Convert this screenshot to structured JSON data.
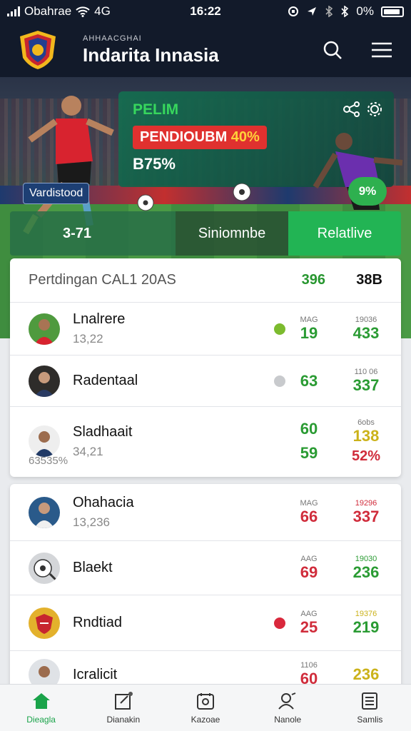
{
  "status_bar": {
    "carrier": "Obahrae",
    "network": "4G",
    "time": "16:22",
    "battery": "0%"
  },
  "header": {
    "subtitle": "AHHAACGHAI",
    "title": "Indarita Innasia"
  },
  "hero": {
    "player_badge": "Vardistood",
    "card_label": "PELIM",
    "pill_text": "PENDIOUBM",
    "pill_highlight": "40%",
    "card_value": "B75%",
    "pct_badge": "9%"
  },
  "segments": [
    "3-71",
    "Siniomnbe",
    "Relatlive"
  ],
  "card1": {
    "header": {
      "title": "Pertdingan CAL1 20AS",
      "col1": "396",
      "col2": "38B"
    },
    "rows": [
      {
        "name": "Lnalrere",
        "meta": "13,22",
        "dot_color": "#7cbb2e",
        "a_small": "MAG",
        "a_big": "19",
        "a_color": "green",
        "b_small": "19036",
        "b_big": "433",
        "b_color": "green"
      },
      {
        "name": "Radentaal",
        "meta": "",
        "dot_color": "#c8cacd",
        "a_small": "",
        "a_big": "63",
        "a_color": "green",
        "b_small": "110 06",
        "b_big": "337",
        "b_color": "green"
      },
      {
        "name": "Sladhaait",
        "meta": "34,21",
        "extra": "63535%",
        "dot_color": "",
        "a_small": "",
        "a_big": "60",
        "a_big2": "59",
        "a_color": "green",
        "b_small": "6obs",
        "b_big": "138",
        "b_big2": "52%",
        "b_color": "yellow"
      }
    ]
  },
  "card2": {
    "rows": [
      {
        "name": "Ohahacia",
        "meta": "13,236",
        "dot_color": "",
        "a_small": "MAG",
        "a_big": "66",
        "a_color": "red",
        "b_small": "19296",
        "b_big": "337",
        "b_color": "red"
      },
      {
        "name": "Blaekt",
        "meta": "",
        "dot_color": "",
        "a_small": "AAG",
        "a_big": "69",
        "a_color": "red",
        "b_small": "19030",
        "b_big": "236",
        "b_color": "green"
      },
      {
        "name": "Rndtiad",
        "meta": "",
        "dot_color": "#d9283c",
        "a_small": "AAG",
        "a_big": "25",
        "a_color": "red",
        "b_small": "19376",
        "b_big": "219",
        "b_color": "green"
      },
      {
        "name": "Icralicit",
        "meta": "",
        "dot_color": "",
        "a_small": "1106",
        "a_big": "60",
        "a_color": "red",
        "b_small": "",
        "b_big": "236",
        "b_color": "yellow"
      }
    ]
  },
  "bottom_nav": [
    {
      "label": "Dieagla",
      "icon": "home-icon",
      "active": true
    },
    {
      "label": "Dianakin",
      "icon": "edit-icon",
      "active": false
    },
    {
      "label": "Kazoae",
      "icon": "calendar-icon",
      "active": false
    },
    {
      "label": "Nanole",
      "icon": "user-search-icon",
      "active": false
    },
    {
      "label": "Samlis",
      "icon": "list-icon",
      "active": false
    }
  ],
  "colors": {
    "accent_green": "#22b454",
    "header_bg": "#121a2a",
    "red": "#d02c3b"
  }
}
